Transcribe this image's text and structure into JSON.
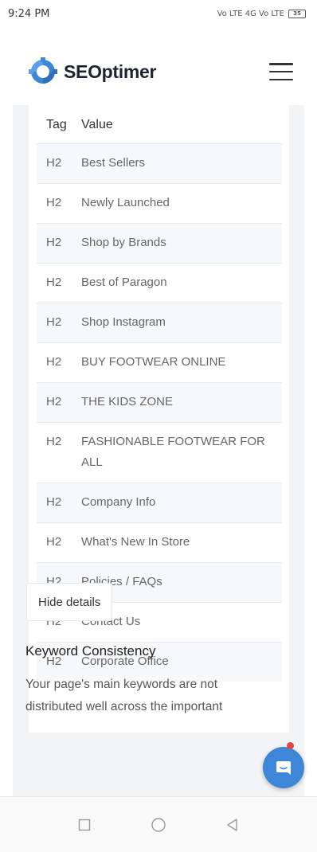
{
  "status": {
    "time": "9:24 PM",
    "signal_text": "Vo LTE 4G Vo LTE",
    "battery": "35"
  },
  "header": {
    "logo_text": "SEOptimer",
    "logo_icon": "seoptimer-logo-icon",
    "menu_icon": "hamburger-menu-icon"
  },
  "table": {
    "headers": [
      "Tag",
      "Value"
    ],
    "rows": [
      {
        "tag": "H2",
        "value": "Best Sellers"
      },
      {
        "tag": "H2",
        "value": "Newly Launched"
      },
      {
        "tag": "H2",
        "value": "Shop by Brands"
      },
      {
        "tag": "H2",
        "value": "Best of Paragon"
      },
      {
        "tag": "H2",
        "value": "Shop Instagram"
      },
      {
        "tag": "H2",
        "value": "BUY FOOTWEAR ONLINE"
      },
      {
        "tag": "H2",
        "value": "THE KIDS ZONE"
      },
      {
        "tag": "H2",
        "value": "FASHIONABLE FOOTWEAR FOR ALL"
      },
      {
        "tag": "H2",
        "value": "Company Info"
      },
      {
        "tag": "H2",
        "value": "What's New In Store"
      },
      {
        "tag": "H2",
        "value": "Policies / FAQs"
      },
      {
        "tag": "H2",
        "value": "Contact Us"
      },
      {
        "tag": "H2",
        "value": "Corporate Office"
      }
    ]
  },
  "hide_details_label": "Hide details",
  "keyword": {
    "title": "Keyword Consistency",
    "description": "Your page's main keywords are not distributed well across the important"
  },
  "colors": {
    "accent": "#3e86d8",
    "notification": "#e04646"
  },
  "icons": {
    "chat": "chat-bubble-icon",
    "nav_recent": "square-recents-icon",
    "nav_home": "circle-home-icon",
    "nav_back": "triangle-back-icon"
  }
}
